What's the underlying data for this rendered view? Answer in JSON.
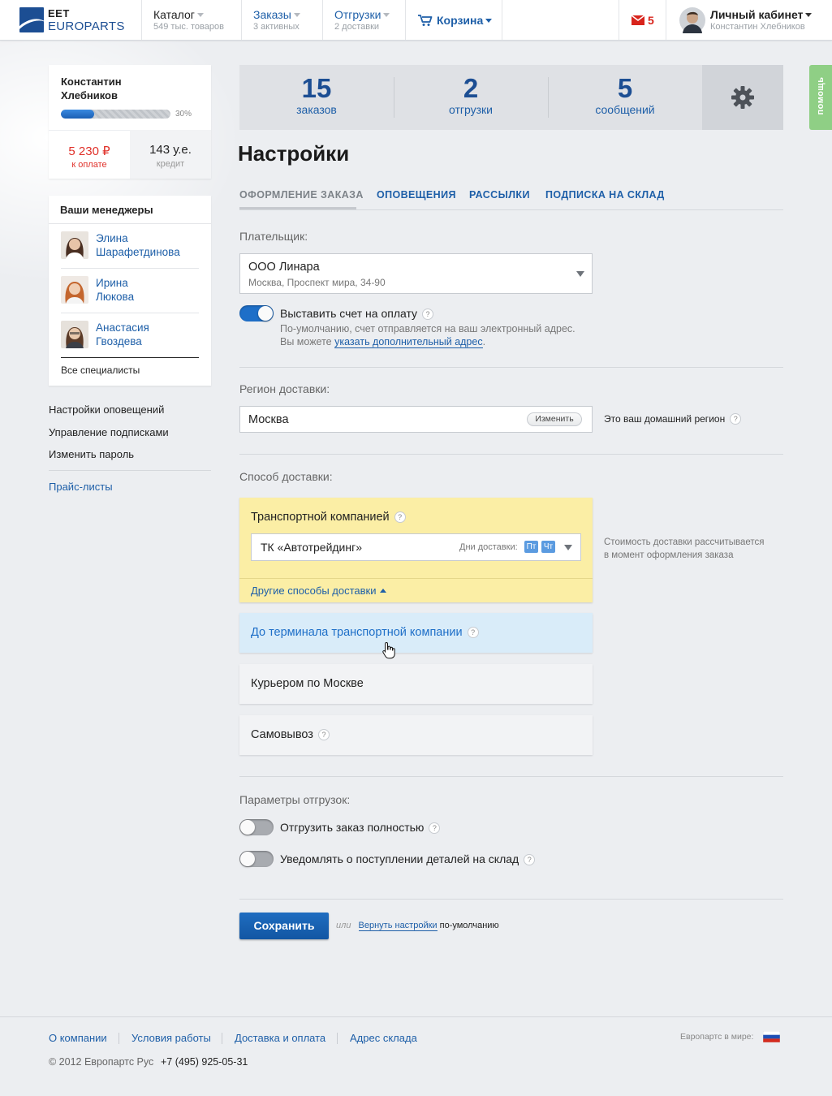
{
  "header": {
    "logo_line1": "EET",
    "logo_line2": "EUROPARTS",
    "nav": [
      {
        "title": "Каталог",
        "sub": "549 тыс. товаров"
      },
      {
        "title": "Заказы",
        "sub": "3 активных"
      },
      {
        "title": "Отгрузки",
        "sub": "2 доставки"
      }
    ],
    "cart": "Корзина",
    "mail_count": "5",
    "account_title": "Личный кабинет",
    "account_name": "Константин Хлебников"
  },
  "help_tab": "помощь",
  "profile": {
    "name": "Константин Хлебников",
    "progress_percent": 30,
    "progress_label": "30%",
    "to_pay_value": "5 230 ₽",
    "to_pay_label": "к оплате",
    "credit_value": "143 у.е.",
    "credit_label": "кредит"
  },
  "managers": {
    "title": "Ваши менеджеры",
    "items": [
      {
        "first": "Элина",
        "last": "Шарафетдинова"
      },
      {
        "first": "Ирина",
        "last": "Люкова"
      },
      {
        "first": "Анастасия",
        "last": "Гвоздева"
      }
    ],
    "all_link": "Все специалисты"
  },
  "side_links": [
    "Настройки оповещений",
    "Управление подписками",
    "Изменить пароль"
  ],
  "price_lists": "Прайс-листы",
  "stats": [
    {
      "value": "15",
      "label": "заказов"
    },
    {
      "value": "2",
      "label": "отгрузки"
    },
    {
      "value": "5",
      "label": "сообщений"
    }
  ],
  "page_title": "Настройки",
  "tabs": [
    "ОФОРМЛЕНИЕ ЗАКАЗА",
    "ОПОВЕЩЕНИЯ",
    "РАССЫЛКИ",
    "ПОДПИСКА НА СКЛАД"
  ],
  "payer": {
    "label": "Плательщик:",
    "name": "ООО Линара",
    "address": "Москва, Проспект мира, 34-90"
  },
  "invoice": {
    "label": "Выставить счет на оплату",
    "on": true,
    "hint1": "По-умолчанию, счет отправляется на ваш электронный адрес.",
    "hint2_prefix": "Вы можете",
    "hint2_link": "указать дополнительный адрес",
    "hint2_suffix": "."
  },
  "region": {
    "label": "Регион доставки:",
    "value": "Москва",
    "change_btn": "Изменить",
    "note": "Это ваш домашний регион"
  },
  "delivery": {
    "label": "Способ доставки:",
    "selected_title": "Транспортной компанией",
    "company": "ТК «Автотрейдинг»",
    "days_label": "Дни доставки:",
    "days": [
      "Пт",
      "Чт"
    ],
    "other_link": "Другие способы доставки",
    "note1": "Стоимость доставки рассчитывается",
    "note2": "в момент оформления заказа",
    "options": [
      "До терминала транспортной компании",
      "Курьером по Москве",
      "Самовывоз"
    ]
  },
  "shipment": {
    "label": "Параметры отгрузок:",
    "opt1": "Отгрузить заказ полностью",
    "opt1_on": false,
    "opt2": "Уведомлять о поступлении деталей на склад",
    "opt2_on": false
  },
  "actions": {
    "save": "Сохранить",
    "or": "или",
    "reset_link": "Вернуть настройки",
    "reset_suffix": "по-умолчанию"
  },
  "footer": {
    "links": [
      "О компании",
      "Условия работы",
      "Доставка и оплата",
      "Адрес склада"
    ],
    "world_label": "Европартс в мире:",
    "copyright": "© 2012 Европартс Рус",
    "phone": "+7 (495) 925-05-31"
  },
  "colors": {
    "accent": "#1e5fa8",
    "pay_red": "#e0312a",
    "selected_yellow": "#fbeea5",
    "hover_blue": "#d9ecf9"
  },
  "icons": [
    "gear-icon",
    "mail-icon",
    "cart-icon",
    "question-icon",
    "cursor-hand-icon",
    "russia-flag-icon"
  ]
}
